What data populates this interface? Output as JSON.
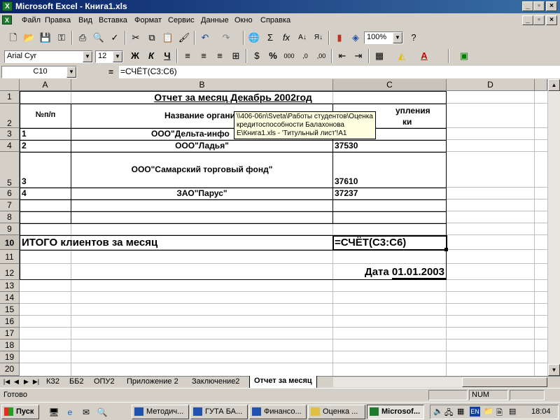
{
  "window": {
    "title": "Microsoft Excel - Книга1.xls"
  },
  "menu": [
    "Файл",
    "Правка",
    "Вид",
    "Вставка",
    "Формат",
    "Сервис",
    "Данные",
    "Окно",
    "Справка"
  ],
  "toolbar": {
    "zoom": "100%",
    "font": "Arial Cyr",
    "size": "12"
  },
  "formula_bar": {
    "cell_ref": "C10",
    "equals": "=",
    "formula": "=СЧЁТ(C3:C6)"
  },
  "columns": [
    "A",
    "B",
    "C",
    "D"
  ],
  "rows": [
    "1",
    "2",
    "3",
    "4",
    "5",
    "6",
    "7",
    "8",
    "9",
    "10",
    "11",
    "12",
    "13",
    "14",
    "15",
    "16",
    "17",
    "18",
    "19",
    "20"
  ],
  "sheet": {
    "title": "Отчет за месяц Декабрь 2002год",
    "col_a_header": "№п/п",
    "col_b_header": "Название организ",
    "col_c_header_line1": "упления",
    "col_c_header_line2": "ки",
    "rows": [
      {
        "num": "1",
        "name": "ООО\"Дельта-инфо",
        "amount": ""
      },
      {
        "num": "2",
        "name": "ООО\"Ладья\"",
        "amount": "37530"
      },
      {
        "num": "3",
        "name": "ООО\"Самарский торговый фонд\"",
        "amount": "37610"
      },
      {
        "num": "4",
        "name": "ЗАО\"Парус\"",
        "amount": "37237"
      }
    ],
    "total_label": "ИТОГО клиентов за месяц",
    "total_formula": "=СЧЁТ(C3:C6)",
    "date_label": "Дата 01.01.2003"
  },
  "tooltip": {
    "line1": "\\\\406-06n\\Sveta\\Работы студентов\\Оценка",
    "line2": "кредитоспособности Балахонова",
    "line3": "Е\\Книга1.xls - 'Титульный лист'!A1"
  },
  "sheet_tabs": [
    "КЗ2",
    "ББ2",
    "ОПУ2",
    "Приложение 2",
    "Заключение2",
    "Отчет за месяц"
  ],
  "status": {
    "left": "Готово",
    "num": "NUM"
  },
  "taskbar": {
    "start": "Пуск",
    "items": [
      "Методич...",
      "ГУТА БА...",
      "Финансо...",
      "Оценка ...",
      "Microsof..."
    ],
    "lang": "EN",
    "clock": "18:04"
  }
}
